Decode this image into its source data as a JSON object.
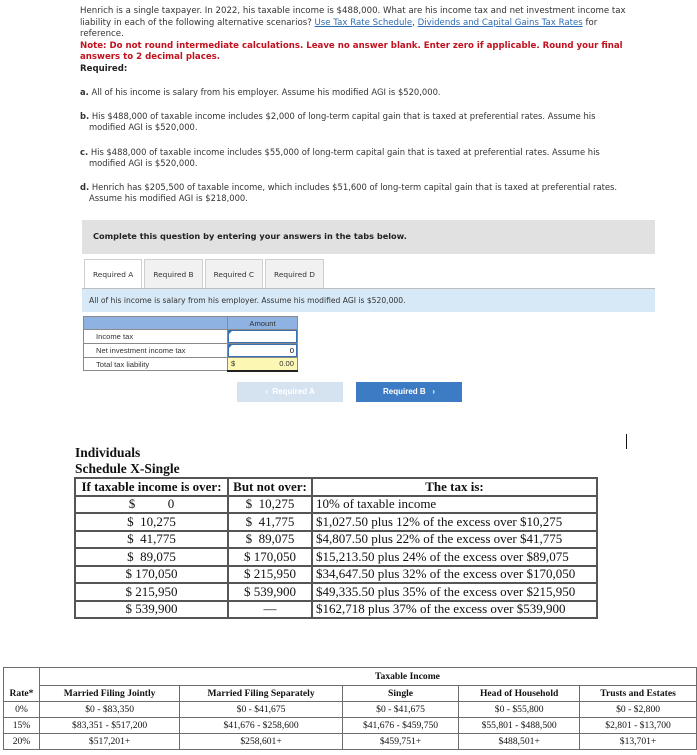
{
  "question": {
    "intro": "Henrich is a single taxpayer. In 2022, his taxable income is $488,000. What are his income tax and net investment income tax liability in each of the following alternative scenarios?",
    "links": [
      "Use Tax Rate Schedule",
      "Dividends and Capital Gains Tax Rates"
    ],
    "link_separator": ",",
    "after_links": "for reference.",
    "note": "Note: Do not round intermediate calculations. Leave no answer blank. Enter zero if applicable. Round your final answers to 2 decimal places.",
    "required_label": "Required:",
    "scenarios": [
      {
        "label": "a.",
        "text": "All of his income is salary from his employer. Assume his modified AGI is $520,000."
      },
      {
        "label": "b.",
        "text": "His $488,000 of taxable income includes $2,000 of long-term capital gain that is taxed at preferential rates. Assume his modified AGI is $520,000."
      },
      {
        "label": "c.",
        "text": "His $488,000 of taxable income includes $55,000 of long-term capital gain that is taxed at preferential rates. Assume his modified AGI is $520,000."
      },
      {
        "label": "d.",
        "text": "Henrich has $205,500 of taxable income, which includes $51,600 of long-term capital gain that is taxed at preferential rates. Assume his modified AGI is $218,000."
      }
    ]
  },
  "complete_box": "Complete this question by entering your answers in the tabs below.",
  "tabs": [
    {
      "label": "Required A",
      "active": true
    },
    {
      "label": "Required B",
      "active": false
    },
    {
      "label": "Required C",
      "active": false
    },
    {
      "label": "Required D",
      "active": false
    }
  ],
  "scenario_bar": "All of his income is salary from his employer. Assume his modified AGI is $520,000.",
  "answer_table": {
    "column_header": "Amount",
    "rows": [
      {
        "label": "Income tax",
        "value": "",
        "placeholder": ""
      },
      {
        "label": "Net investment income tax",
        "value": "0",
        "placeholder": ""
      },
      {
        "label": "Total tax liability",
        "currency": "$",
        "value": "0.00"
      }
    ]
  },
  "nav": {
    "prev_label": "Required A",
    "prev_icon": "‹",
    "next_label": "Required B",
    "next_icon": "›"
  },
  "schedule": {
    "title_line1": "Individuals",
    "title_line2": "Schedule X-Single",
    "headers": [
      "If taxable income is over:",
      "But not over:",
      "The tax is:"
    ],
    "rows": [
      [
        "$          0",
        "$  10,275",
        "10% of taxable income"
      ],
      [
        "$  10,275",
        "$  41,775",
        "$1,027.50 plus 12% of the excess over $10,275"
      ],
      [
        "$  41,775",
        "$  89,075",
        "$4,807.50 plus 22% of the excess over $41,775"
      ],
      [
        "$  89,075",
        "$ 170,050",
        "$15,213.50 plus 24% of the excess over $89,075"
      ],
      [
        "$ 170,050",
        "$ 215,950",
        "$34,647.50 plus 32% of the excess over $170,050"
      ],
      [
        "$ 215,950",
        "$ 539,900",
        "$49,335.50 plus 35% of the excess over $215,950"
      ],
      [
        "$ 539,900",
        "—",
        "$162,718 plus 37% of the excess over $539,900"
      ]
    ]
  },
  "capital_gains": {
    "group_header": "Taxable Income",
    "headers": [
      "Rate*",
      "Married Filing Jointly",
      "Married Filing Separately",
      "Single",
      "Head of Household",
      "Trusts and Estates"
    ],
    "rows": [
      [
        "0%",
        "$0 - $83,350",
        "$0 - $41,675",
        "$0 - $41,675",
        "$0 - $55,800",
        "$0 - $2,800"
      ],
      [
        "15%",
        "$83,351 - $517,200",
        "$41,676 - $258,600",
        "$41,676 - $459,750",
        "$55,801 - $488,500",
        "$2,801 - $13,700"
      ],
      [
        "20%",
        "$517,201+",
        "$258,601+",
        "$459,751+",
        "$488,501+",
        "$13,701+"
      ]
    ]
  }
}
